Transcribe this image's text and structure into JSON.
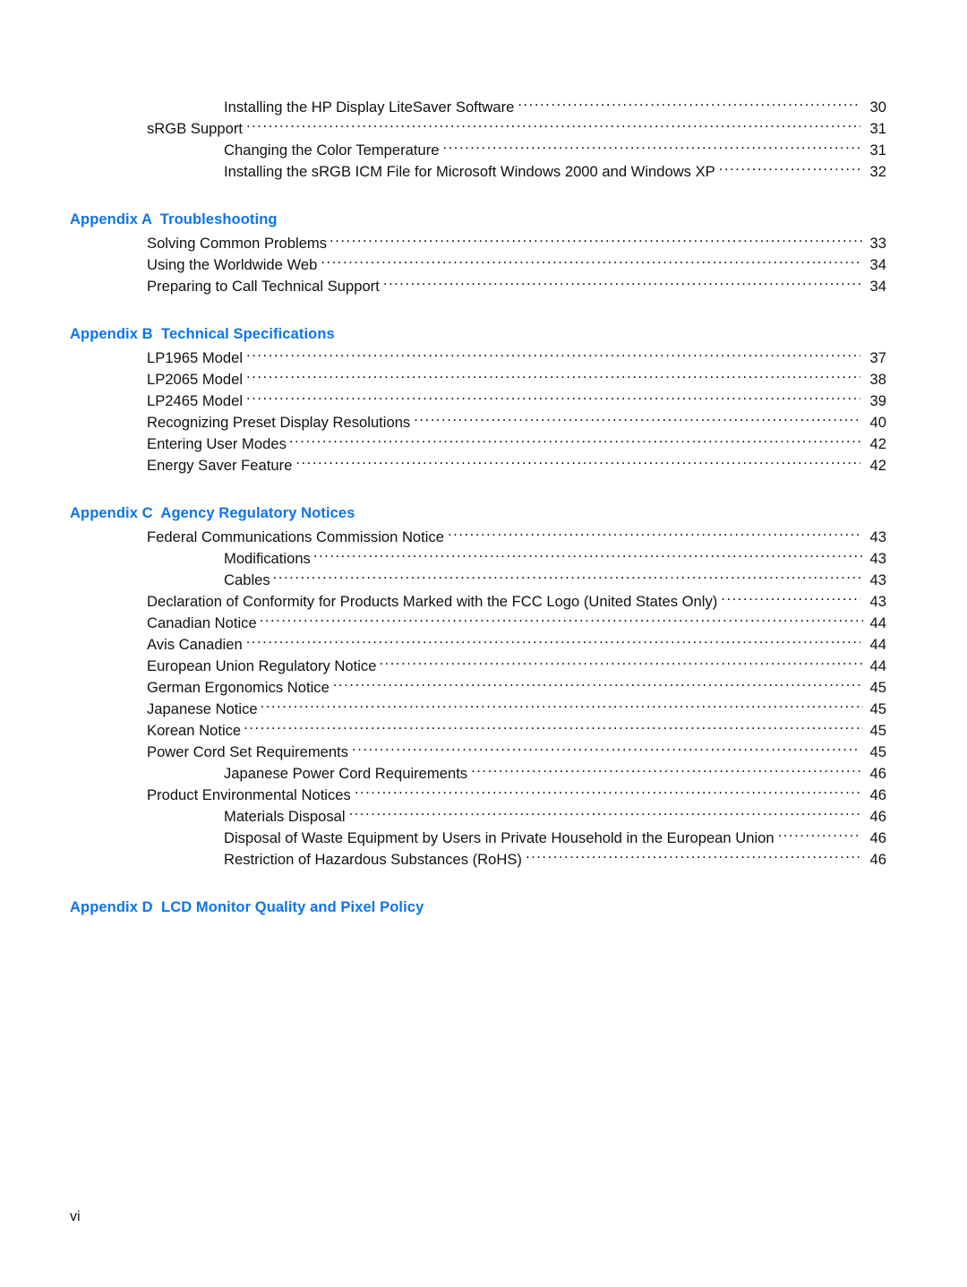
{
  "document": {
    "type": "table-of-contents",
    "folio": "vi"
  },
  "colors": {
    "heading_blue": "#0d74ec",
    "body_text": "#111111",
    "page_background": "#ffffff"
  },
  "toc": {
    "continued_entries": [
      {
        "label": "Installing the HP Display LiteSaver Software",
        "page": "30",
        "level": 2,
        "tight": false
      },
      {
        "label": "sRGB Support",
        "page": "31",
        "level": 1,
        "tight": false
      },
      {
        "label": "Changing the Color Temperature",
        "page": "31",
        "level": 2,
        "tight": false
      },
      {
        "label": "Installing the sRGB ICM File for Microsoft Windows 2000 and Windows XP",
        "page": "32",
        "level": 2,
        "tight": false
      }
    ],
    "sections": [
      {
        "heading_number": "Appendix A",
        "heading_title": "Troubleshooting",
        "heading_full": "Appendix A  Troubleshooting",
        "entries": [
          {
            "label": "Solving Common Problems",
            "page": "33",
            "level": 1,
            "tight": true
          },
          {
            "label": "Using the Worldwide Web",
            "page": "34",
            "level": 1,
            "tight": false
          },
          {
            "label": "Preparing to Call Technical Support",
            "page": "34",
            "level": 1,
            "tight": false
          }
        ]
      },
      {
        "heading_number": "Appendix B",
        "heading_title": "Technical Specifications",
        "heading_full": "Appendix B  Technical Specifications",
        "entries": [
          {
            "label": "LP1965 Model",
            "page": "37",
            "level": 1,
            "tight": false
          },
          {
            "label": "LP2065 Model",
            "page": "38",
            "level": 1,
            "tight": false
          },
          {
            "label": "LP2465 Model",
            "page": "39",
            "level": 1,
            "tight": false
          },
          {
            "label": "Recognizing Preset Display Resolutions",
            "page": "40",
            "level": 1,
            "tight": false
          },
          {
            "label": "Entering User Modes",
            "page": "42",
            "level": 1,
            "tight": true
          },
          {
            "label": "Energy Saver Feature",
            "page": "42",
            "level": 1,
            "tight": false
          }
        ]
      },
      {
        "heading_number": "Appendix C",
        "heading_title": "Agency Regulatory Notices",
        "heading_full": "Appendix C  Agency Regulatory Notices",
        "entries": [
          {
            "label": "Federal Communications Commission Notice",
            "page": "43",
            "level": 1,
            "tight": false
          },
          {
            "label": "Modifications",
            "page": "43",
            "level": 2,
            "tight": true
          },
          {
            "label": "Cables",
            "page": "43",
            "level": 2,
            "tight": true
          },
          {
            "label": "Declaration of Conformity for Products Marked with the FCC Logo (United States Only)",
            "page": "43",
            "level": 1,
            "tight": false
          },
          {
            "label": "Canadian Notice",
            "page": "44",
            "level": 1,
            "tight": true
          },
          {
            "label": "Avis Canadien",
            "page": "44",
            "level": 1,
            "tight": false
          },
          {
            "label": "European Union Regulatory Notice",
            "page": "44",
            "level": 1,
            "tight": true
          },
          {
            "label": "German Ergonomics Notice",
            "page": "45",
            "level": 1,
            "tight": false
          },
          {
            "label": "Japanese Notice",
            "page": "45",
            "level": 1,
            "tight": true
          },
          {
            "label": "Korean Notice",
            "page": "45",
            "level": 1,
            "tight": true
          },
          {
            "label": "Power Cord Set Requirements",
            "page": "45",
            "level": 1,
            "tight": false
          },
          {
            "label": "Japanese Power Cord Requirements",
            "page": "46",
            "level": 2,
            "tight": false
          },
          {
            "label": "Product Environmental Notices",
            "page": "46",
            "level": 1,
            "tight": false
          },
          {
            "label": "Materials Disposal",
            "page": "46",
            "level": 2,
            "tight": false
          },
          {
            "label": "Disposal of Waste Equipment by Users in Private Household in the European Union",
            "page": "46",
            "level": 2,
            "tight": false
          },
          {
            "label": "Restriction of Hazardous Substances (RoHS)",
            "page": "46",
            "level": 2,
            "tight": false
          }
        ]
      },
      {
        "heading_number": "Appendix D",
        "heading_title": "LCD Monitor Quality and Pixel Policy",
        "heading_full": "Appendix D  LCD Monitor Quality and Pixel Policy",
        "entries": []
      }
    ]
  }
}
